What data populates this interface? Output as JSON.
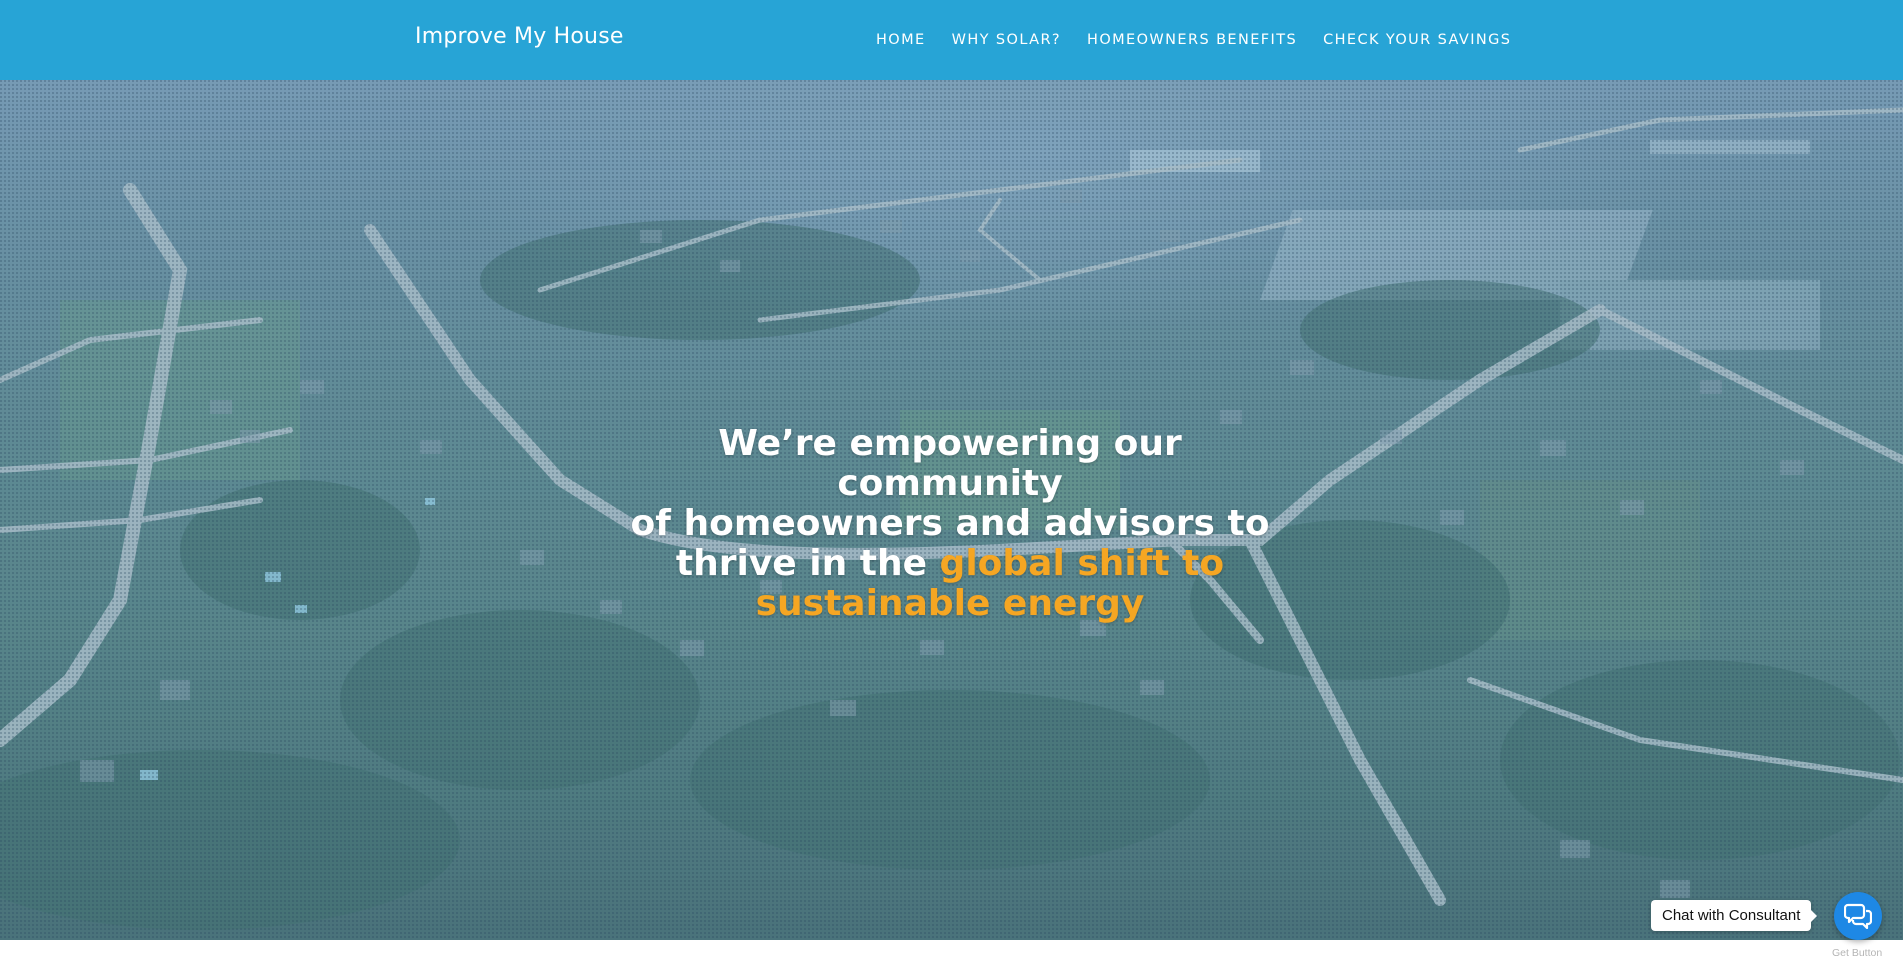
{
  "header": {
    "brand": "Improve My House",
    "nav": [
      {
        "label": "HOME"
      },
      {
        "label": "WHY SOLAR?"
      },
      {
        "label": "HOMEOWNERS BENEFITS"
      },
      {
        "label": "CHECK YOUR SAVINGS"
      }
    ]
  },
  "hero": {
    "headline_line1": "We’re empowering our community",
    "headline_line2": "of homeowners and advisors to",
    "headline_line3_plain": "thrive in the ",
    "headline_line3_accent": "global shift to",
    "headline_line4_accent": "sustainable energy",
    "background_icon": "aerial-neighborhood-photo"
  },
  "chat": {
    "label": "Chat with Consultant",
    "icon": "chat-bubbles-icon",
    "get_button": "Get Button"
  },
  "colors": {
    "header_bg": "#27a4d6",
    "accent": "#f5a623",
    "chat_button": "#1e88e5"
  }
}
